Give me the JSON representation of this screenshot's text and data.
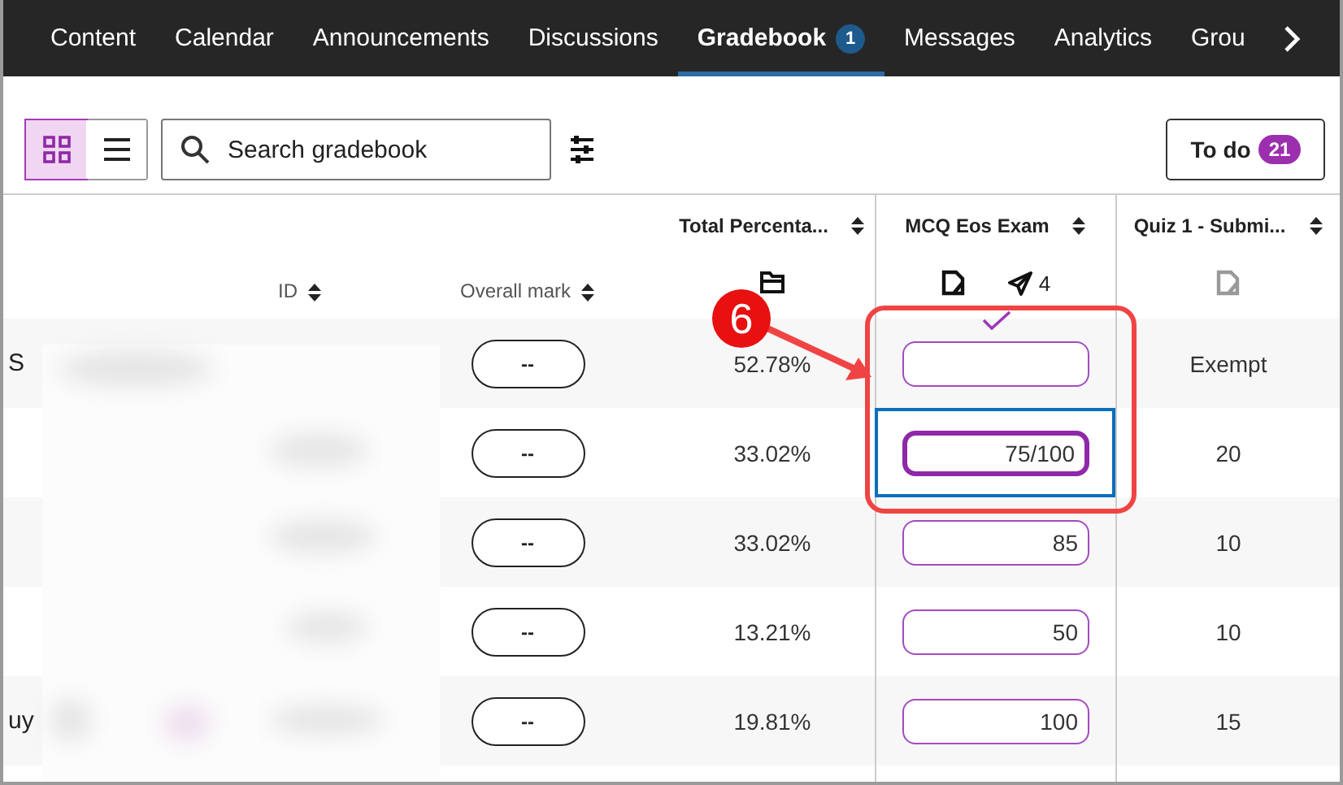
{
  "nav": {
    "tabs": [
      {
        "label": "Content",
        "selected": false
      },
      {
        "label": "Calendar",
        "selected": false
      },
      {
        "label": "Announcements",
        "selected": false
      },
      {
        "label": "Discussions",
        "selected": false
      },
      {
        "label": "Gradebook",
        "selected": true,
        "badge": "1"
      },
      {
        "label": "Messages",
        "selected": false
      },
      {
        "label": "Analytics",
        "selected": false
      },
      {
        "label": "Grou",
        "selected": false
      }
    ]
  },
  "toolbar": {
    "views": [
      {
        "kind": "grid",
        "selected": true
      },
      {
        "kind": "list",
        "selected": false
      }
    ],
    "search": {
      "placeholder": "Search gradebook"
    },
    "todo": {
      "label": "To do",
      "count": "21"
    }
  },
  "table": {
    "columns": [
      {
        "kind": "id",
        "label": "ID"
      },
      {
        "kind": "mark",
        "label": "Overall mark"
      },
      {
        "kind": "total",
        "label": "Total Percenta..."
      },
      {
        "kind": "exam",
        "label": "MCQ Eos Exam",
        "submissions": "4"
      },
      {
        "kind": "quiz",
        "label": "Quiz 1 - Submi..."
      }
    ],
    "rows": [
      {
        "name": "S",
        "overall_mark": "--",
        "total": "52.78%",
        "exam": "",
        "saved": true,
        "focused": false,
        "quiz": "Exempt"
      },
      {
        "name": "",
        "overall_mark": "--",
        "total": "33.02%",
        "exam": "75/100",
        "saved": false,
        "focused": true,
        "quiz": "20"
      },
      {
        "name": "",
        "overall_mark": "--",
        "total": "33.02%",
        "exam": "85",
        "saved": false,
        "focused": false,
        "quiz": "10"
      },
      {
        "name": "",
        "overall_mark": "--",
        "total": "13.21%",
        "exam": "50",
        "saved": false,
        "focused": false,
        "quiz": "10"
      },
      {
        "name": "uy",
        "overall_mark": "--",
        "total": "19.81%",
        "exam": "100",
        "saved": false,
        "focused": false,
        "quiz": "15"
      }
    ]
  },
  "annotation": {
    "number": "6"
  }
}
